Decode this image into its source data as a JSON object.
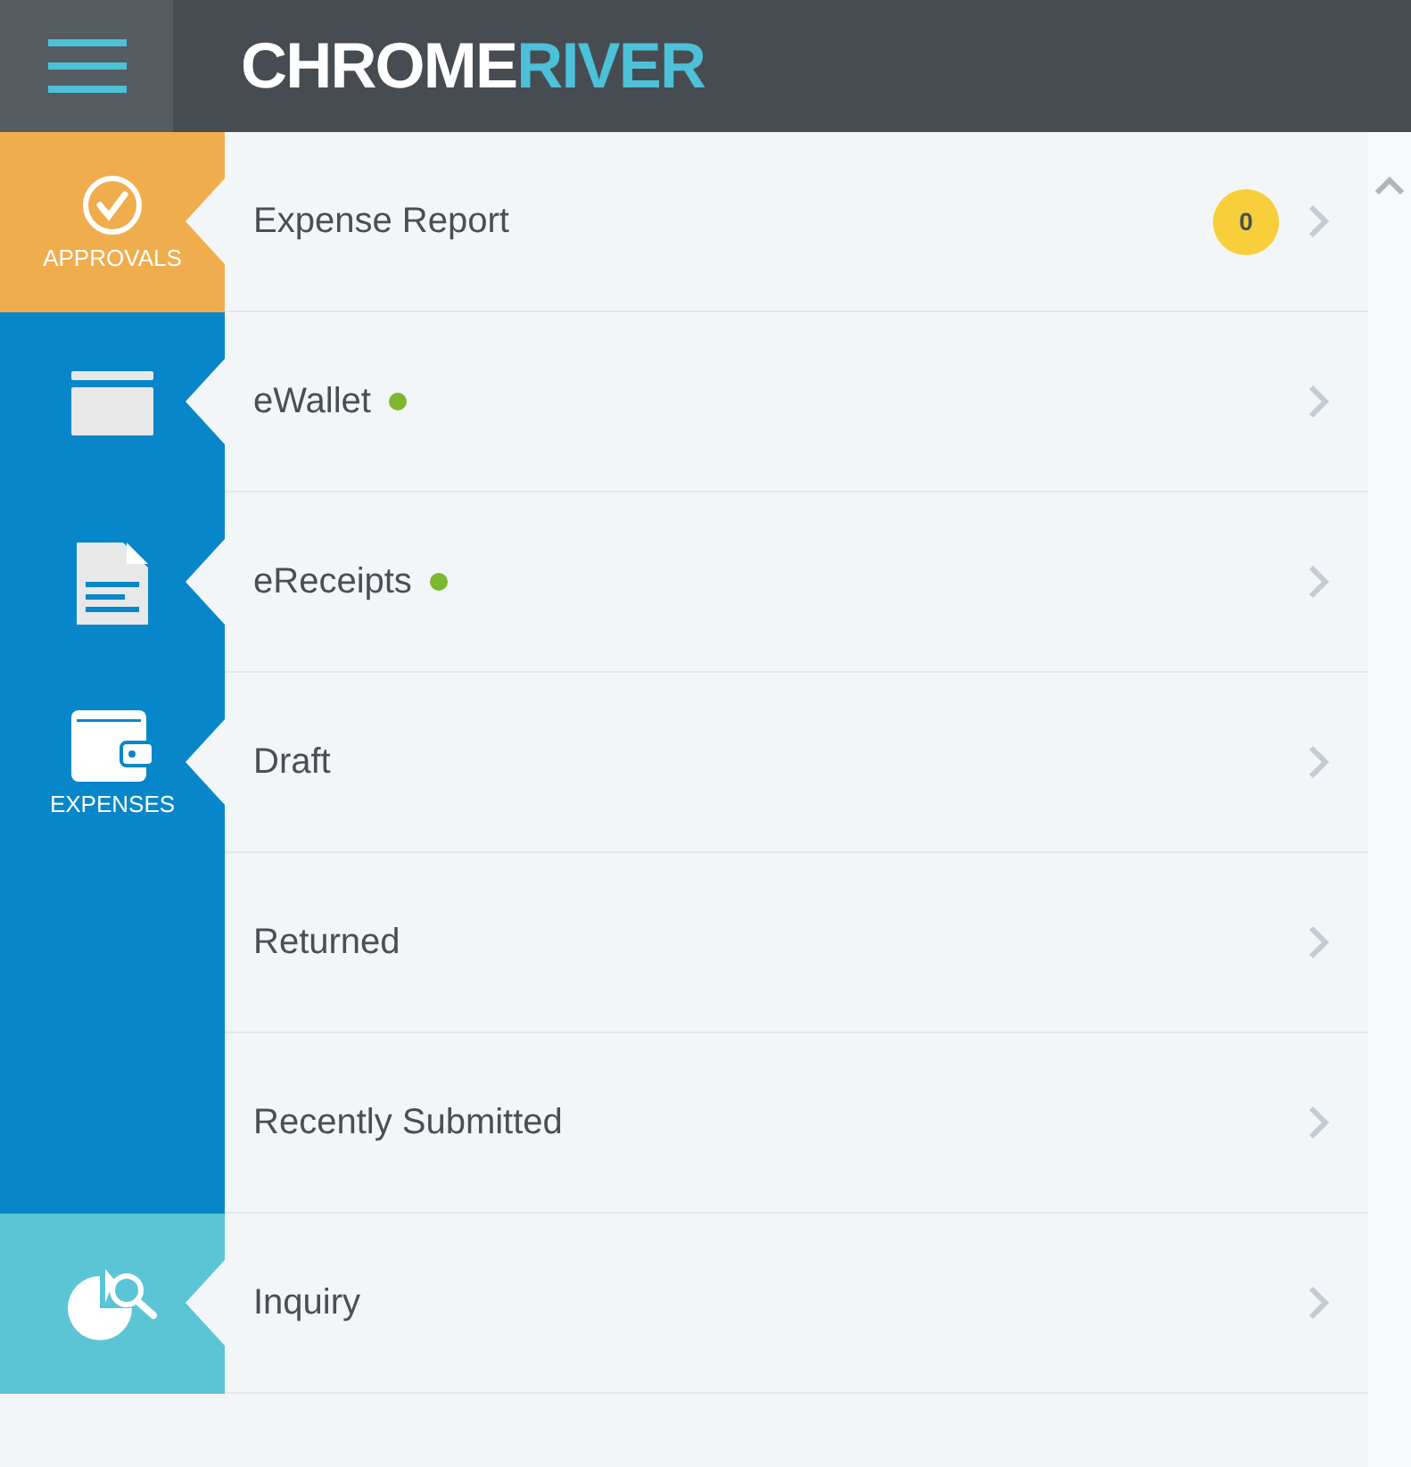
{
  "header": {
    "logo": {
      "first": "CHROME",
      "second": "RIVER"
    }
  },
  "rows": [
    {
      "label": "Expense Report",
      "color": "#f0ad4e",
      "kind": "check",
      "nav_label": "APPROVALS",
      "dot": false,
      "badge": "0"
    },
    {
      "label": "eWallet",
      "color": "#0787c9",
      "kind": "card",
      "dot": true
    },
    {
      "label": "eReceipts",
      "color": "#0787c9",
      "kind": "document",
      "dot": true
    },
    {
      "label": "Draft",
      "color": "#0787c9",
      "kind": "wallet",
      "nav_label": "EXPENSES",
      "dot": false
    },
    {
      "label": "Returned",
      "color": "#0787c9",
      "kind": "plain",
      "dot": false
    },
    {
      "label": "Recently Submitted",
      "color": "#0787c9",
      "kind": "plain",
      "dot": false
    },
    {
      "label": "Inquiry",
      "color": "#5bc5d6",
      "kind": "inquiry",
      "dot": false
    }
  ]
}
